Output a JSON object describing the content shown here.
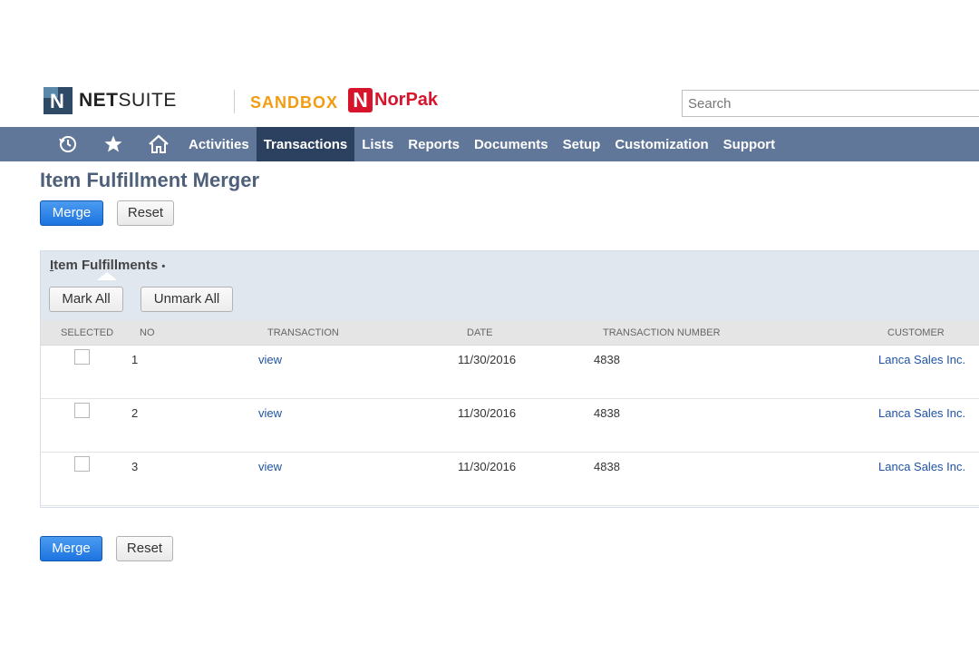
{
  "header": {
    "logo_brand_bold": "NET",
    "logo_brand_regular": "SUITE",
    "logo_mark_letter": "N",
    "environment_label": "SANDBOX",
    "company_letter": "N",
    "company_name": "NorPak",
    "search_placeholder": "Search"
  },
  "nav": {
    "icons": [
      "history-icon",
      "star-icon",
      "home-icon"
    ],
    "items": [
      {
        "label": "Activities"
      },
      {
        "label": "Transactions",
        "active": true
      },
      {
        "label": "Lists"
      },
      {
        "label": "Reports"
      },
      {
        "label": "Documents"
      },
      {
        "label": "Setup"
      },
      {
        "label": "Customization"
      },
      {
        "label": "Support"
      }
    ]
  },
  "page": {
    "title": "Item Fulfillment Merger",
    "merge_label": "Merge",
    "reset_label": "Reset"
  },
  "sublist": {
    "tab_label_first": "I",
    "tab_label_rest": "tem Fulfillments",
    "tab_marker": "•",
    "mark_all_label": "Mark All",
    "unmark_all_label": "Unmark All",
    "columns": [
      "SELECTED",
      "NO",
      "TRANSACTION",
      "DATE",
      "TRANSACTION NUMBER",
      "CUSTOMER"
    ],
    "rows": [
      {
        "selected": false,
        "no": "1",
        "transaction": "view",
        "date": "11/30/2016",
        "number": "4838",
        "customer": "Lanca Sales Inc."
      },
      {
        "selected": false,
        "no": "2",
        "transaction": "view",
        "date": "11/30/2016",
        "number": "4838",
        "customer": "Lanca Sales Inc."
      },
      {
        "selected": false,
        "no": "3",
        "transaction": "view",
        "date": "11/30/2016",
        "number": "4838",
        "customer": "Lanca Sales Inc."
      }
    ]
  },
  "colors": {
    "nav_bg": "#607799",
    "nav_active_bg": "#2c4160",
    "primary_button": "#1d74e0",
    "link": "#1f53a4",
    "sandbox": "#f29c11",
    "company_brand": "#d6152d"
  }
}
